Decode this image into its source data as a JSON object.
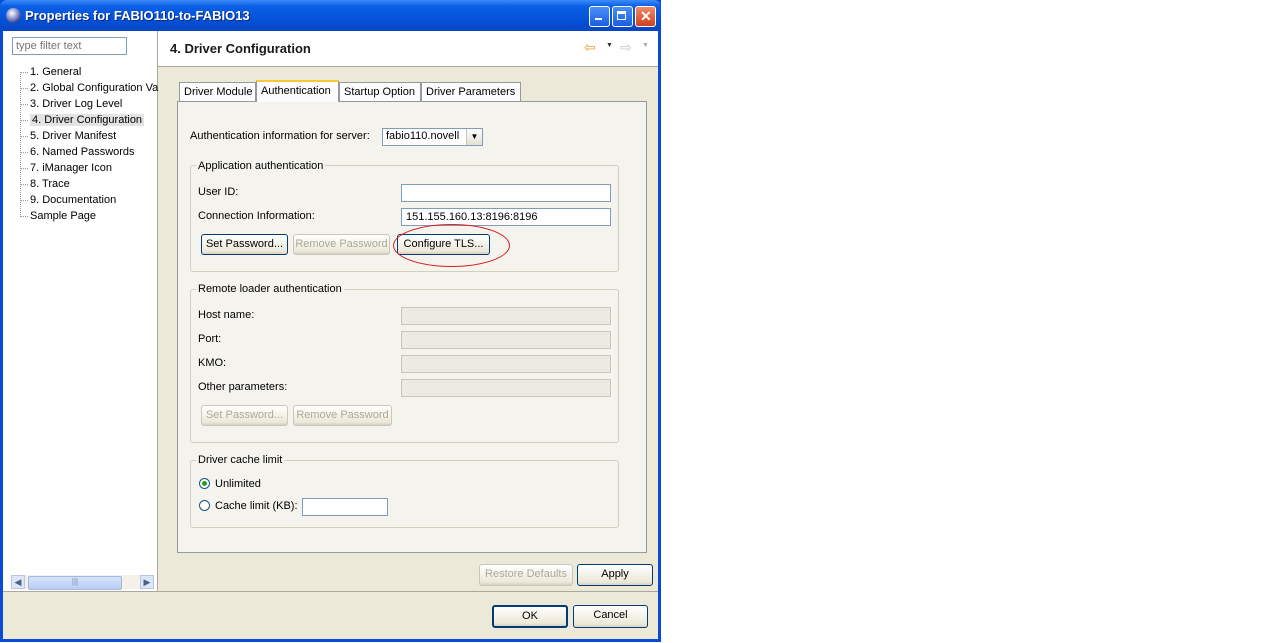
{
  "window": {
    "title": "Properties for FABIO110-to-FABIO13",
    "controls": {
      "minimize": "_",
      "maximize": "□",
      "close": "✕"
    }
  },
  "left": {
    "filter_placeholder": "type filter text",
    "tree": [
      "1. General",
      "2. Global Configuration Va",
      "3. Driver Log Level",
      "4. Driver Configuration",
      "5. Driver Manifest",
      "6. Named Passwords",
      "7. iManager Icon",
      "8. Trace",
      "9. Documentation",
      "Sample Page"
    ],
    "selected_index": 3
  },
  "header": {
    "title": "4. Driver Configuration"
  },
  "tabs": [
    "Driver Module",
    "Authentication",
    "Startup Option",
    "Driver Parameters"
  ],
  "active_tab": "Authentication",
  "auth": {
    "server_label": "Authentication information for server:",
    "server_value": "fabio110.novell",
    "app_group": "Application authentication",
    "user_id_label": "User ID:",
    "user_id_value": "",
    "conn_label": "Connection Information:",
    "conn_value": "151.155.160.13:8196:8196",
    "set_password": "Set Password...",
    "remove_password": "Remove Password",
    "configure_tls": "Configure TLS..."
  },
  "remote": {
    "group": "Remote loader authentication",
    "host_label": "Host name:",
    "port_label": "Port:",
    "kmo_label": "KMO:",
    "other_label": "Other parameters:",
    "set_password": "Set Password...",
    "remove_password": "Remove Password"
  },
  "cache": {
    "group": "Driver cache limit",
    "unlimited": "Unlimited",
    "cache_limit": "Cache limit (KB):",
    "selected": "Unlimited",
    "cache_value": ""
  },
  "buttons": {
    "restore": "Restore Defaults",
    "apply": "Apply",
    "ok": "OK",
    "cancel": "Cancel"
  },
  "colors": {
    "titlebar": "#0553d8",
    "dialog_bg": "#ece9d8",
    "annotation": "#d81e1e"
  }
}
